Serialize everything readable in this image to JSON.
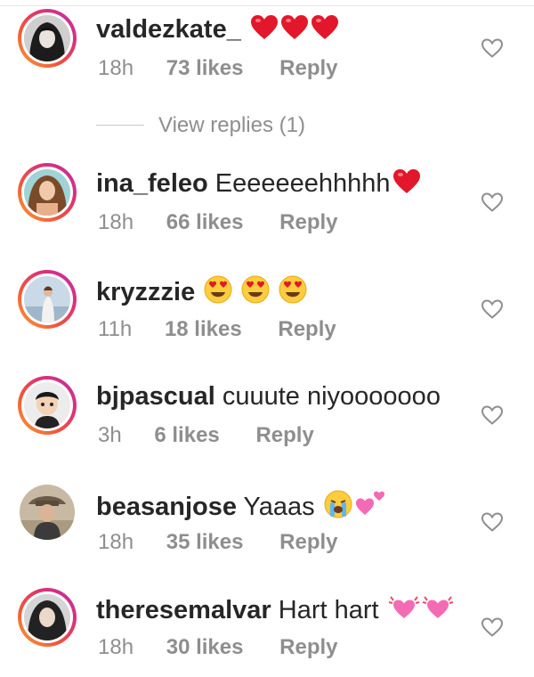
{
  "comments": [
    {
      "username": "valdezkate_",
      "text": "",
      "emojis": [
        "red-heart",
        "red-heart",
        "red-heart"
      ],
      "time": "18h",
      "likes": "73 likes",
      "reply": "Reply",
      "avatar_ring": true
    },
    {
      "username": "ina_feleo",
      "text": "Eeeeeeehhhhh",
      "emojis": [
        "red-heart"
      ],
      "time": "18h",
      "likes": "66 likes",
      "reply": "Reply",
      "avatar_ring": true
    },
    {
      "username": "kryzzzie",
      "text": "",
      "emojis": [
        "heart-eyes",
        "heart-eyes",
        "heart-eyes"
      ],
      "time": "11h",
      "likes": "18 likes",
      "reply": "Reply",
      "avatar_ring": true
    },
    {
      "username": "bjpascual",
      "text": "cuuute niyooooooo",
      "emojis": [],
      "time": "3h",
      "likes": "6 likes",
      "reply": "Reply",
      "avatar_ring": true
    },
    {
      "username": "beasanjose",
      "text": "Yaaas",
      "emojis": [
        "crying-face",
        "two-hearts"
      ],
      "time": "18h",
      "likes": "35 likes",
      "reply": "Reply",
      "avatar_ring": false
    },
    {
      "username": "theresemalvar",
      "text": "Hart hart",
      "emojis": [
        "beating-heart",
        "beating-heart"
      ],
      "time": "18h",
      "likes": "30 likes",
      "reply": "Reply",
      "avatar_ring": true
    }
  ],
  "view_replies": "View replies (1)",
  "icons": {
    "like": "heart-outline-icon"
  },
  "colors": {
    "muted": "#8e8e8e",
    "text": "#262626",
    "like_icon": "#8e8e8e"
  }
}
